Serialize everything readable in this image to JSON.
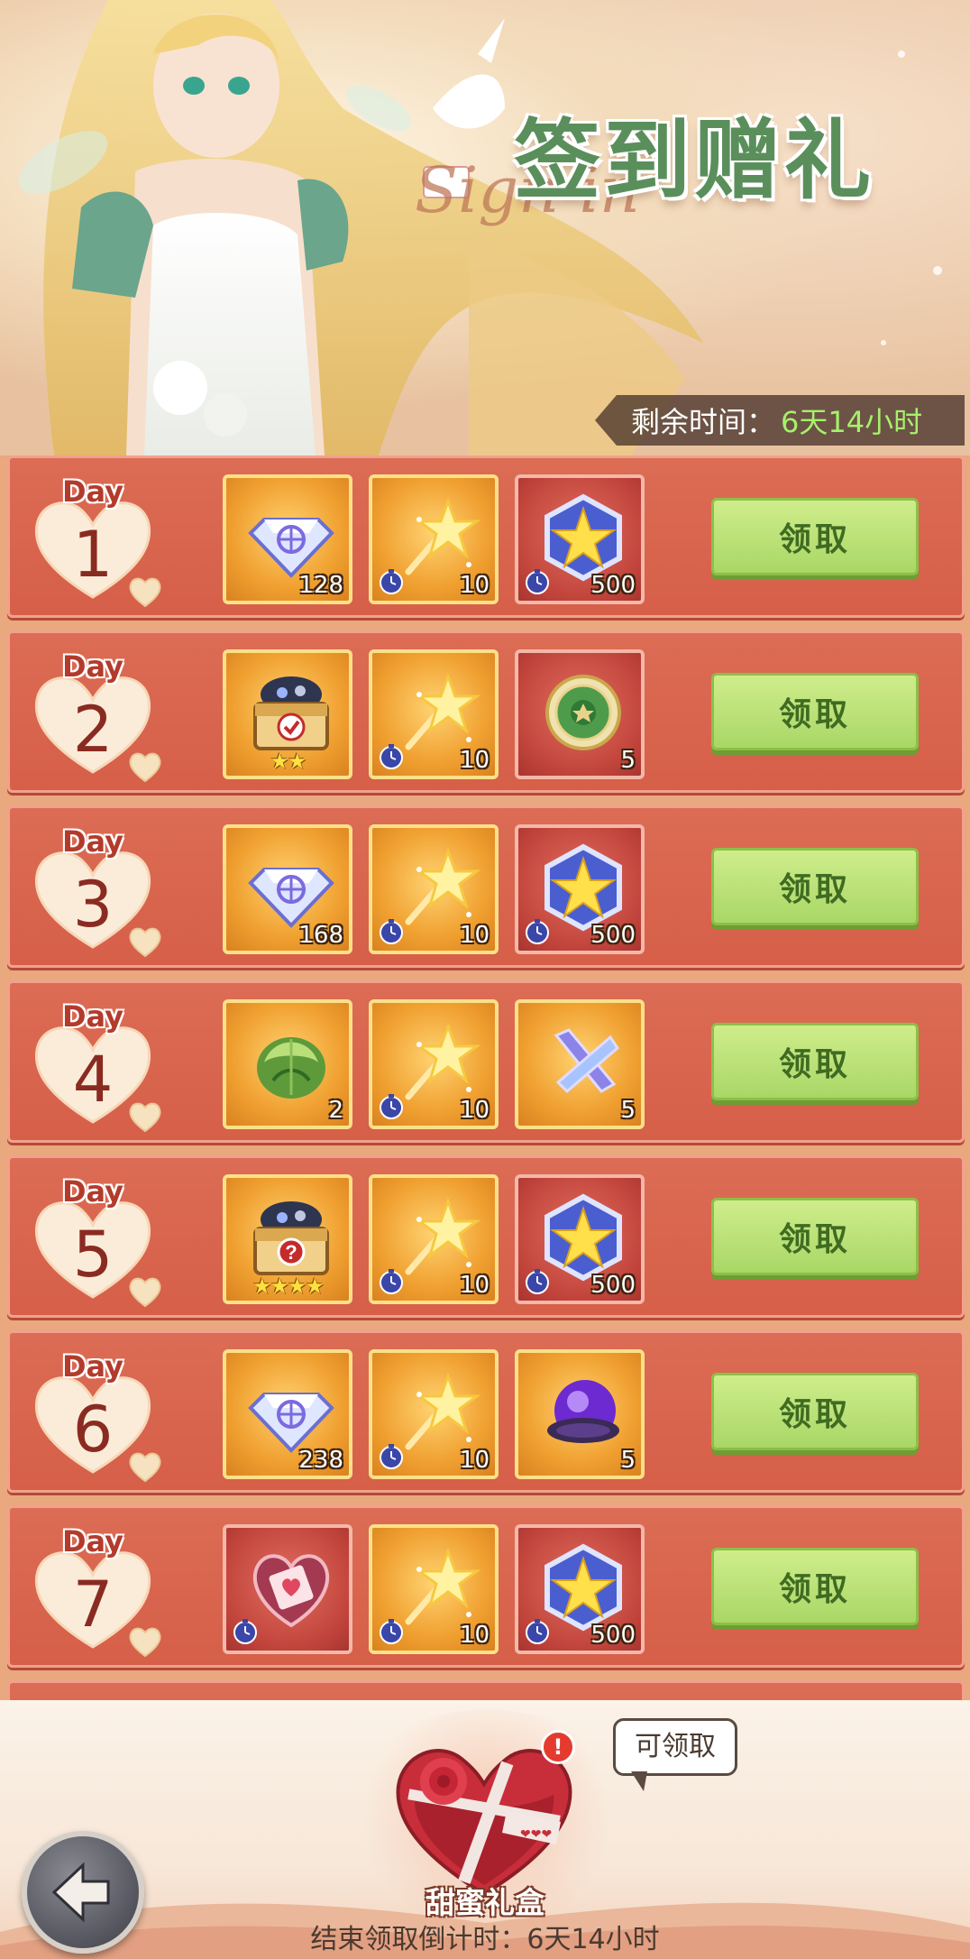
{
  "banner": {
    "title": "签到赠礼",
    "script_text": "Sign in",
    "timer_label": "剩余时间：",
    "timer_value": "6天14小时"
  },
  "colors": {
    "row_bg": "#d65f48",
    "claim_bg": "#a9d766",
    "timer_value": "#a6f06a"
  },
  "days": [
    {
      "day_label": "Day",
      "number": "1",
      "claim_label": "领取",
      "items": [
        {
          "icon": "diamond-icon",
          "frame": "gold",
          "qty": "128",
          "timed": false
        },
        {
          "icon": "star-wand-icon",
          "frame": "gold",
          "qty": "10",
          "timed": true
        },
        {
          "icon": "star-badge-icon",
          "frame": "red",
          "qty": "500",
          "timed": true
        }
      ]
    },
    {
      "day_label": "Day",
      "number": "2",
      "claim_label": "领取",
      "items": [
        {
          "icon": "selection-chest-icon",
          "frame": "gold",
          "qty": "",
          "stars": "★★",
          "timed": false
        },
        {
          "icon": "star-wand-icon",
          "frame": "gold",
          "qty": "10",
          "timed": true
        },
        {
          "icon": "green-medal-icon",
          "frame": "red",
          "qty": "5",
          "timed": false
        }
      ]
    },
    {
      "day_label": "Day",
      "number": "3",
      "claim_label": "领取",
      "items": [
        {
          "icon": "diamond-icon",
          "frame": "gold",
          "qty": "168",
          "timed": false
        },
        {
          "icon": "star-wand-icon",
          "frame": "gold",
          "qty": "10",
          "timed": true
        },
        {
          "icon": "star-badge-icon",
          "frame": "red",
          "qty": "500",
          "timed": true
        }
      ]
    },
    {
      "day_label": "Day",
      "number": "4",
      "claim_label": "领取",
      "items": [
        {
          "icon": "green-crystal-icon",
          "frame": "gold",
          "qty": "2",
          "timed": false
        },
        {
          "icon": "star-wand-icon",
          "frame": "gold",
          "qty": "10",
          "timed": true
        },
        {
          "icon": "cross-crystal-icon",
          "frame": "gold",
          "qty": "5",
          "timed": false
        }
      ]
    },
    {
      "day_label": "Day",
      "number": "5",
      "claim_label": "领取",
      "items": [
        {
          "icon": "mystery-chest-icon",
          "frame": "gold",
          "qty": "",
          "stars": "★★★★",
          "timed": false
        },
        {
          "icon": "star-wand-icon",
          "frame": "gold",
          "qty": "10",
          "timed": true
        },
        {
          "icon": "star-badge-icon",
          "frame": "red",
          "qty": "500",
          "timed": true
        }
      ]
    },
    {
      "day_label": "Day",
      "number": "6",
      "claim_label": "领取",
      "items": [
        {
          "icon": "diamond-icon",
          "frame": "gold",
          "qty": "238",
          "timed": false
        },
        {
          "icon": "star-wand-icon",
          "frame": "gold",
          "qty": "10",
          "timed": true
        },
        {
          "icon": "purple-orb-icon",
          "frame": "gold",
          "qty": "5",
          "timed": false
        }
      ]
    },
    {
      "day_label": "Day",
      "number": "7",
      "claim_label": "领取",
      "items": [
        {
          "icon": "love-card-icon",
          "frame": "red",
          "qty": "",
          "timed": true
        },
        {
          "icon": "star-wand-icon",
          "frame": "gold",
          "qty": "10",
          "timed": true
        },
        {
          "icon": "star-badge-icon",
          "frame": "red",
          "qty": "500",
          "timed": true
        }
      ]
    }
  ],
  "bottom": {
    "bubble_text": "可领取",
    "alert_mark": "!",
    "gift_label": "甜蜜礼盒",
    "countdown_label": "结束领取倒计时：",
    "countdown_value": "6天14小时"
  }
}
